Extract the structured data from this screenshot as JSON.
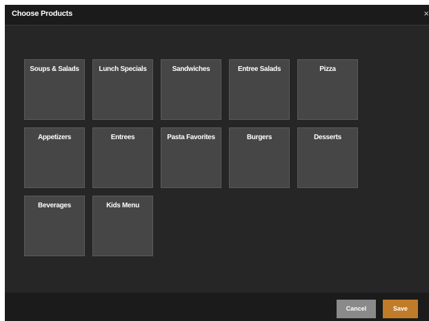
{
  "dialog": {
    "title": "Choose Products",
    "close_symbol": "×"
  },
  "categories": [
    {
      "label": "Soups & Salads"
    },
    {
      "label": "Lunch Specials"
    },
    {
      "label": "Sandwiches"
    },
    {
      "label": "Entree Salads"
    },
    {
      "label": "Pizza"
    },
    {
      "label": "Appetizers"
    },
    {
      "label": "Entrees"
    },
    {
      "label": "Pasta Favorites"
    },
    {
      "label": "Burgers"
    },
    {
      "label": "Desserts"
    },
    {
      "label": "Beverages"
    },
    {
      "label": "Kids Menu"
    }
  ],
  "footer": {
    "cancel_label": "Cancel",
    "save_label": "Save"
  },
  "colors": {
    "background": "#262626",
    "tile": "#464646",
    "cancel": "#8a8a8a",
    "save_accent": "#c07c28"
  }
}
